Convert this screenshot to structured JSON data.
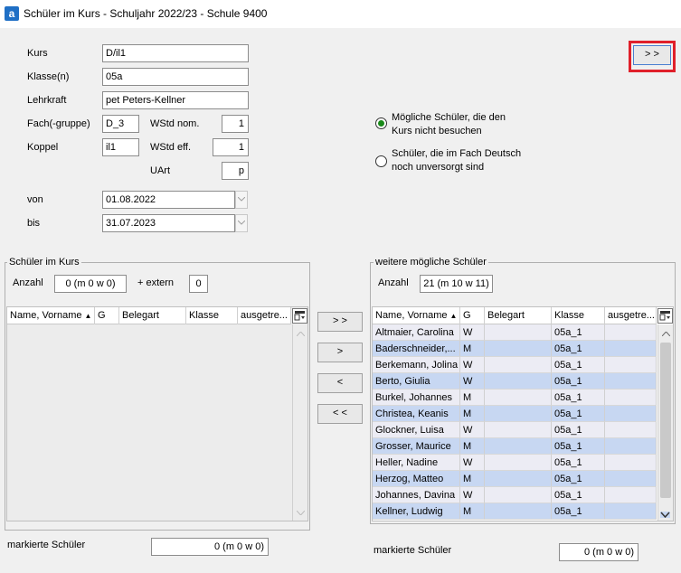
{
  "window": {
    "title": "Schüler im Kurs - Schuljahr 2022/23 - Schule 9400",
    "app_icon": "a"
  },
  "form": {
    "kurs_label": "Kurs",
    "kurs_value": "D/il1",
    "klasse_label": "Klasse(n)",
    "klasse_value": "05a",
    "lehrkraft_label": "Lehrkraft",
    "lehrkraft_value": "pet Peters-Kellner",
    "fach_label": "Fach(-gruppe)",
    "fach_value": "D_3",
    "koppel_label": "Koppel",
    "koppel_value": "il1",
    "wstd_nom_label": "WStd nom.",
    "wstd_nom_value": "1",
    "wstd_eff_label": "WStd eff.",
    "wstd_eff_value": "1",
    "uart_label": "UArt",
    "uart_value": "p",
    "von_label": "von",
    "von_value": "01.08.2022",
    "bis_label": "bis",
    "bis_value": "31.07.2023"
  },
  "top_button": {
    "label": "> >"
  },
  "radios": {
    "option1_line1": "Mögliche Schüler, die den",
    "option1_line2": "Kurs nicht besuchen",
    "option2_line1": "Schüler, die im Fach Deutsch",
    "option2_line2": "noch unversorgt sind",
    "selected": 1
  },
  "left_panel": {
    "title": "Schüler im Kurs",
    "anzahl_label": "Anzahl",
    "anzahl_value": "0 (m 0 w 0)",
    "extern_label": "+ extern",
    "extern_value": "0",
    "columns": [
      "Name, Vorname",
      "G",
      "Belegart",
      "Klasse",
      "ausgetre..."
    ],
    "markiert_label": "markierte Schüler",
    "markiert_value": "0 (m 0 w 0)"
  },
  "transfer_buttons": {
    "all_right": "> >",
    "right": ">",
    "left": "<",
    "all_left": "< <"
  },
  "right_panel": {
    "title": "weitere mögliche Schüler",
    "anzahl_label": "Anzahl",
    "anzahl_value": "21 (m 10 w 11)",
    "columns": [
      "Name, Vorname",
      "G",
      "Belegart",
      "Klasse",
      "ausgetre..."
    ],
    "rows": [
      {
        "name": "Altmaier, Carolina",
        "g": "W",
        "belegart": "",
        "klasse": "05a_1",
        "ausgetreten": ""
      },
      {
        "name": "Baderschneider,...",
        "g": "M",
        "belegart": "",
        "klasse": "05a_1",
        "ausgetreten": ""
      },
      {
        "name": "Berkemann, Jolina",
        "g": "W",
        "belegart": "",
        "klasse": "05a_1",
        "ausgetreten": ""
      },
      {
        "name": "Berto, Giulia",
        "g": "W",
        "belegart": "",
        "klasse": "05a_1",
        "ausgetreten": ""
      },
      {
        "name": "Burkel, Johannes",
        "g": "M",
        "belegart": "",
        "klasse": "05a_1",
        "ausgetreten": ""
      },
      {
        "name": "Christea, Keanis",
        "g": "M",
        "belegart": "",
        "klasse": "05a_1",
        "ausgetreten": ""
      },
      {
        "name": "Glockner, Luisa",
        "g": "W",
        "belegart": "",
        "klasse": "05a_1",
        "ausgetreten": ""
      },
      {
        "name": "Grosser, Maurice",
        "g": "M",
        "belegart": "",
        "klasse": "05a_1",
        "ausgetreten": ""
      },
      {
        "name": "Heller, Nadine",
        "g": "W",
        "belegart": "",
        "klasse": "05a_1",
        "ausgetreten": ""
      },
      {
        "name": "Herzog, Matteo",
        "g": "M",
        "belegart": "",
        "klasse": "05a_1",
        "ausgetreten": ""
      },
      {
        "name": "Johannes, Davina",
        "g": "W",
        "belegart": "",
        "klasse": "05a_1",
        "ausgetreten": ""
      },
      {
        "name": "Kellner, Ludwig",
        "g": "M",
        "belegart": "",
        "klasse": "05a_1",
        "ausgetreten": ""
      }
    ],
    "markiert_label": "markierte Schüler",
    "markiert_value": "0 (m 0 w 0)"
  },
  "colors": {
    "row_odd": "#ececf4",
    "row_even": "#c7d7f2",
    "highlight": "#e0202a",
    "radio_dot": "#1a8a1a"
  }
}
